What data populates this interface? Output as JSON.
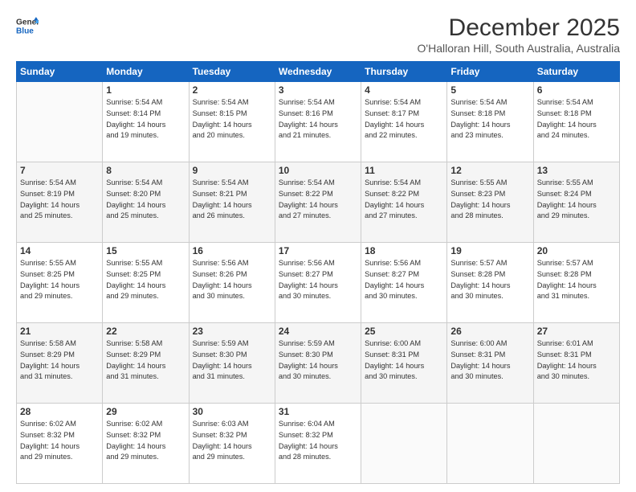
{
  "logo": {
    "line1": "General",
    "line2": "Blue"
  },
  "title": "December 2025",
  "subtitle": "O'Halloran Hill, South Australia, Australia",
  "days_header": [
    "Sunday",
    "Monday",
    "Tuesday",
    "Wednesday",
    "Thursday",
    "Friday",
    "Saturday"
  ],
  "weeks": [
    [
      {
        "day": "",
        "info": ""
      },
      {
        "day": "1",
        "info": "Sunrise: 5:54 AM\nSunset: 8:14 PM\nDaylight: 14 hours\nand 19 minutes."
      },
      {
        "day": "2",
        "info": "Sunrise: 5:54 AM\nSunset: 8:15 PM\nDaylight: 14 hours\nand 20 minutes."
      },
      {
        "day": "3",
        "info": "Sunrise: 5:54 AM\nSunset: 8:16 PM\nDaylight: 14 hours\nand 21 minutes."
      },
      {
        "day": "4",
        "info": "Sunrise: 5:54 AM\nSunset: 8:17 PM\nDaylight: 14 hours\nand 22 minutes."
      },
      {
        "day": "5",
        "info": "Sunrise: 5:54 AM\nSunset: 8:18 PM\nDaylight: 14 hours\nand 23 minutes."
      },
      {
        "day": "6",
        "info": "Sunrise: 5:54 AM\nSunset: 8:18 PM\nDaylight: 14 hours\nand 24 minutes."
      }
    ],
    [
      {
        "day": "7",
        "info": "Sunrise: 5:54 AM\nSunset: 8:19 PM\nDaylight: 14 hours\nand 25 minutes."
      },
      {
        "day": "8",
        "info": "Sunrise: 5:54 AM\nSunset: 8:20 PM\nDaylight: 14 hours\nand 25 minutes."
      },
      {
        "day": "9",
        "info": "Sunrise: 5:54 AM\nSunset: 8:21 PM\nDaylight: 14 hours\nand 26 minutes."
      },
      {
        "day": "10",
        "info": "Sunrise: 5:54 AM\nSunset: 8:22 PM\nDaylight: 14 hours\nand 27 minutes."
      },
      {
        "day": "11",
        "info": "Sunrise: 5:54 AM\nSunset: 8:22 PM\nDaylight: 14 hours\nand 27 minutes."
      },
      {
        "day": "12",
        "info": "Sunrise: 5:55 AM\nSunset: 8:23 PM\nDaylight: 14 hours\nand 28 minutes."
      },
      {
        "day": "13",
        "info": "Sunrise: 5:55 AM\nSunset: 8:24 PM\nDaylight: 14 hours\nand 29 minutes."
      }
    ],
    [
      {
        "day": "14",
        "info": "Sunrise: 5:55 AM\nSunset: 8:25 PM\nDaylight: 14 hours\nand 29 minutes."
      },
      {
        "day": "15",
        "info": "Sunrise: 5:55 AM\nSunset: 8:25 PM\nDaylight: 14 hours\nand 29 minutes."
      },
      {
        "day": "16",
        "info": "Sunrise: 5:56 AM\nSunset: 8:26 PM\nDaylight: 14 hours\nand 30 minutes."
      },
      {
        "day": "17",
        "info": "Sunrise: 5:56 AM\nSunset: 8:27 PM\nDaylight: 14 hours\nand 30 minutes."
      },
      {
        "day": "18",
        "info": "Sunrise: 5:56 AM\nSunset: 8:27 PM\nDaylight: 14 hours\nand 30 minutes."
      },
      {
        "day": "19",
        "info": "Sunrise: 5:57 AM\nSunset: 8:28 PM\nDaylight: 14 hours\nand 30 minutes."
      },
      {
        "day": "20",
        "info": "Sunrise: 5:57 AM\nSunset: 8:28 PM\nDaylight: 14 hours\nand 31 minutes."
      }
    ],
    [
      {
        "day": "21",
        "info": "Sunrise: 5:58 AM\nSunset: 8:29 PM\nDaylight: 14 hours\nand 31 minutes."
      },
      {
        "day": "22",
        "info": "Sunrise: 5:58 AM\nSunset: 8:29 PM\nDaylight: 14 hours\nand 31 minutes."
      },
      {
        "day": "23",
        "info": "Sunrise: 5:59 AM\nSunset: 8:30 PM\nDaylight: 14 hours\nand 31 minutes."
      },
      {
        "day": "24",
        "info": "Sunrise: 5:59 AM\nSunset: 8:30 PM\nDaylight: 14 hours\nand 30 minutes."
      },
      {
        "day": "25",
        "info": "Sunrise: 6:00 AM\nSunset: 8:31 PM\nDaylight: 14 hours\nand 30 minutes."
      },
      {
        "day": "26",
        "info": "Sunrise: 6:00 AM\nSunset: 8:31 PM\nDaylight: 14 hours\nand 30 minutes."
      },
      {
        "day": "27",
        "info": "Sunrise: 6:01 AM\nSunset: 8:31 PM\nDaylight: 14 hours\nand 30 minutes."
      }
    ],
    [
      {
        "day": "28",
        "info": "Sunrise: 6:02 AM\nSunset: 8:32 PM\nDaylight: 14 hours\nand 29 minutes."
      },
      {
        "day": "29",
        "info": "Sunrise: 6:02 AM\nSunset: 8:32 PM\nDaylight: 14 hours\nand 29 minutes."
      },
      {
        "day": "30",
        "info": "Sunrise: 6:03 AM\nSunset: 8:32 PM\nDaylight: 14 hours\nand 29 minutes."
      },
      {
        "day": "31",
        "info": "Sunrise: 6:04 AM\nSunset: 8:32 PM\nDaylight: 14 hours\nand 28 minutes."
      },
      {
        "day": "",
        "info": ""
      },
      {
        "day": "",
        "info": ""
      },
      {
        "day": "",
        "info": ""
      }
    ]
  ]
}
